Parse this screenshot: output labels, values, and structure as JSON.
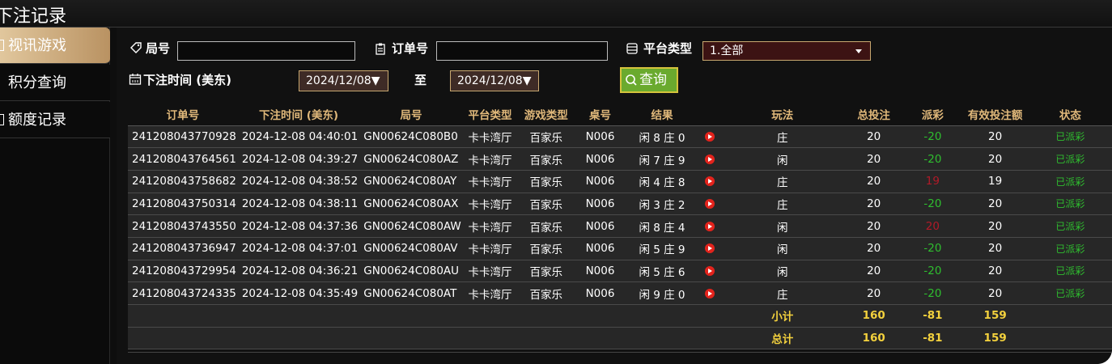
{
  "title": "下注记录",
  "sidebar": {
    "items": [
      {
        "label": "视讯游戏",
        "active": true
      },
      {
        "label": "积分查询",
        "active": false
      },
      {
        "label": "额度记录",
        "active": false
      }
    ]
  },
  "filters": {
    "round_label": "局号",
    "round_value": "",
    "order_label": "订单号",
    "order_value": "",
    "platform_label": "平台类型",
    "platform_value": "1.全部",
    "time_label": "下注时间 (美东)",
    "date_from": "2024/12/08▼",
    "to_label": "至",
    "date_to": "2024/12/08▼",
    "query_label": "查询"
  },
  "table": {
    "headers": [
      "订单号",
      "下注时间 (美东)",
      "局号",
      "平台类型",
      "游戏类型",
      "桌号",
      "结果",
      "",
      "玩法",
      "总投注",
      "派彩",
      "有效投注额",
      "状态"
    ],
    "rows": [
      {
        "order": "241208043770928",
        "time": "2024-12-08 04:40:01",
        "round": "GN00624C080B0",
        "platform": "卡卡湾厅",
        "game": "百家乐",
        "table": "N006",
        "result": "闲 8 庄 0",
        "play": "庄",
        "bet": "20",
        "payout": "-20",
        "payout_color": "#2fbe2f",
        "valid": "20",
        "status": "已派彩"
      },
      {
        "order": "241208043764561",
        "time": "2024-12-08 04:39:27",
        "round": "GN00624C080AZ",
        "platform": "卡卡湾厅",
        "game": "百家乐",
        "table": "N006",
        "result": "闲 7 庄 9",
        "play": "闲",
        "bet": "20",
        "payout": "-20",
        "payout_color": "#2fbe2f",
        "valid": "20",
        "status": "已派彩"
      },
      {
        "order": "241208043758682",
        "time": "2024-12-08 04:38:52",
        "round": "GN00624C080AY",
        "platform": "卡卡湾厅",
        "game": "百家乐",
        "table": "N006",
        "result": "闲 4 庄 8",
        "play": "庄",
        "bet": "20",
        "payout": "19",
        "payout_color": "#b21a28",
        "valid": "19",
        "status": "已派彩"
      },
      {
        "order": "241208043750314",
        "time": "2024-12-08 04:38:11",
        "round": "GN00624C080AX",
        "platform": "卡卡湾厅",
        "game": "百家乐",
        "table": "N006",
        "result": "闲 3 庄 2",
        "play": "庄",
        "bet": "20",
        "payout": "-20",
        "payout_color": "#2fbe2f",
        "valid": "20",
        "status": "已派彩"
      },
      {
        "order": "241208043743550",
        "time": "2024-12-08 04:37:36",
        "round": "GN00624C080AW",
        "platform": "卡卡湾厅",
        "game": "百家乐",
        "table": "N006",
        "result": "闲 8 庄 4",
        "play": "闲",
        "bet": "20",
        "payout": "20",
        "payout_color": "#b21a28",
        "valid": "20",
        "status": "已派彩"
      },
      {
        "order": "241208043736947",
        "time": "2024-12-08 04:37:01",
        "round": "GN00624C080AV",
        "platform": "卡卡湾厅",
        "game": "百家乐",
        "table": "N006",
        "result": "闲 5 庄 9",
        "play": "闲",
        "bet": "20",
        "payout": "-20",
        "payout_color": "#2fbe2f",
        "valid": "20",
        "status": "已派彩"
      },
      {
        "order": "241208043729954",
        "time": "2024-12-08 04:36:21",
        "round": "GN00624C080AU",
        "platform": "卡卡湾厅",
        "game": "百家乐",
        "table": "N006",
        "result": "闲 5 庄 6",
        "play": "闲",
        "bet": "20",
        "payout": "-20",
        "payout_color": "#2fbe2f",
        "valid": "20",
        "status": "已派彩"
      },
      {
        "order": "241208043724335",
        "time": "2024-12-08 04:35:49",
        "round": "GN00624C080AT",
        "platform": "卡卡湾厅",
        "game": "百家乐",
        "table": "N006",
        "result": "闲 9 庄 0",
        "play": "庄",
        "bet": "20",
        "payout": "-20",
        "payout_color": "#2fbe2f",
        "valid": "20",
        "status": "已派彩"
      }
    ],
    "subtotal": {
      "label": "小计",
      "bet": "160",
      "payout": "-81",
      "valid": "159"
    },
    "total": {
      "label": "总计",
      "bet": "160",
      "payout": "-81",
      "valid": "159"
    }
  },
  "colors": {
    "accent_gold": "#e0b87a",
    "status_green": "#2fbe2f",
    "payout_red": "#b21a28",
    "sum_yellow": "#f3d13d"
  }
}
